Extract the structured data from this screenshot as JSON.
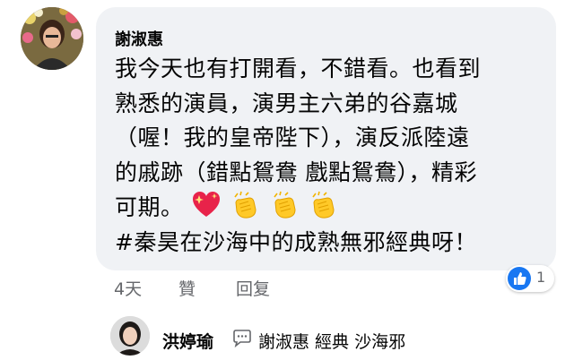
{
  "comment": {
    "author": "謝淑惠",
    "lines": [
      "我今天也有打開看，不錯看。也看到",
      "熟悉的演員，演男主六弟的谷嘉城",
      "（喔！我的皇帝陛下），演反派陸遠",
      "的戚跡（錯點鴛鴦 戲點鴛鴦），精彩",
      "可期。",
      "#秦昊在沙海中的成熟無邪經典呀！"
    ],
    "emojis": [
      "sparkling-heart",
      "clapping-hands",
      "clapping-hands",
      "clapping-hands"
    ],
    "reaction_count": "1",
    "time": "4天",
    "like_label": "贊",
    "reply_label": "回复"
  },
  "reply": {
    "author": "洪婷瑜",
    "text": "謝淑惠 經典 沙海邪"
  },
  "colors": {
    "bubble": "#f0f2f5",
    "like_blue": "#1877f2",
    "meta_gray": "#65676b"
  }
}
